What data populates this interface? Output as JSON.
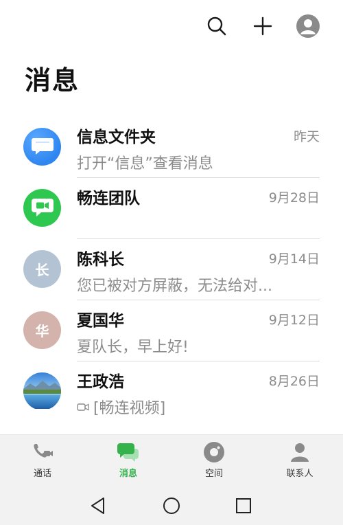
{
  "header": {
    "title": "消息"
  },
  "conversations": [
    {
      "name": "信息文件夹",
      "preview": "打开“信息”查看消息",
      "time": "昨天",
      "avatar_icon": "message-bubble-icon",
      "avatar_color": "#2f86f0"
    },
    {
      "name": "畅连团队",
      "preview": "",
      "time": "9月28日",
      "avatar_icon": "video-camera-icon",
      "avatar_color": "#2ec74f"
    },
    {
      "name": "陈科长",
      "preview": "您已被对方屏蔽，无法给对...",
      "time": "9月14日",
      "avatar_char": "长",
      "avatar_color": "#b3c3d3"
    },
    {
      "name": "夏国华",
      "preview": "夏队长，早上好!",
      "time": "9月12日",
      "avatar_char": "华",
      "avatar_color": "#d3b3ab"
    },
    {
      "name": "王政浩",
      "preview": "[畅连视频]",
      "time": "8月26日",
      "avatar_icon": "landscape-photo-icon",
      "preview_icon": "video-icon"
    }
  ],
  "tabs": [
    {
      "label": "通话",
      "icon": "phone-video-icon"
    },
    {
      "label": "消息",
      "icon": "chat-bubbles-icon",
      "active": true
    },
    {
      "label": "空间",
      "icon": "space-icon"
    },
    {
      "label": "联系人",
      "icon": "contacts-icon"
    }
  ],
  "colors": {
    "accent": "#36b24d",
    "secondary_text": "#8c8c8c"
  }
}
